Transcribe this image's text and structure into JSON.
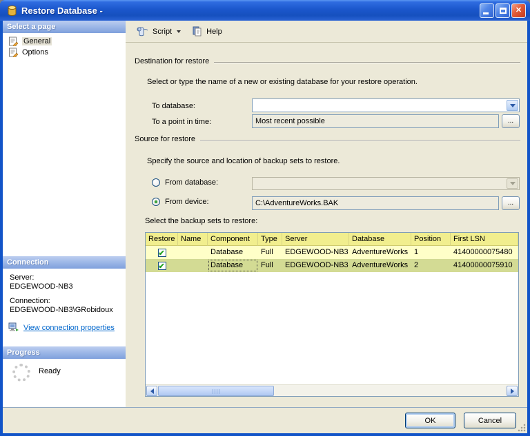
{
  "window": {
    "title": "Restore Database -"
  },
  "sidebar": {
    "select_page": {
      "header": "Select a page",
      "items": [
        {
          "label": "General"
        },
        {
          "label": "Options"
        }
      ]
    },
    "connection": {
      "header": "Connection",
      "server_label": "Server:",
      "server_value": "EDGEWOOD-NB3",
      "connection_label": "Connection:",
      "connection_value": "EDGEWOOD-NB3\\GRobidoux",
      "link_label": "View connection properties"
    },
    "progress": {
      "header": "Progress",
      "status": "Ready"
    }
  },
  "toolbar": {
    "script": "Script",
    "help": "Help"
  },
  "main": {
    "destination": {
      "group": "Destination for restore",
      "description": "Select or type the name of a new or existing database for your restore operation.",
      "to_database_label": "To database:",
      "to_database_value": "",
      "to_point_label": "To a point in time:",
      "to_point_value": "Most recent possible",
      "browse": "..."
    },
    "source": {
      "group": "Source for restore",
      "description": "Specify the source and location of backup sets to restore.",
      "from_database_label": "From database:",
      "from_database_value": "",
      "from_device_label": "From device:",
      "from_device_value": "C:\\AdventureWorks.BAK",
      "browse": "...",
      "backup_sets_label": "Select the backup sets to restore:"
    }
  },
  "table": {
    "columns": [
      "Restore",
      "Name",
      "Component",
      "Type",
      "Server",
      "Database",
      "Position",
      "First LSN"
    ],
    "rows": [
      {
        "restore_checked": true,
        "name": "",
        "component": "Database",
        "type": "Full",
        "server": "EDGEWOOD-NB3",
        "database": "AdventureWorks",
        "position": "1",
        "first_lsn": "41400000075480"
      },
      {
        "restore_checked": true,
        "name": "",
        "component": "Database",
        "type": "Full",
        "server": "EDGEWOOD-NB3",
        "database": "AdventureWorks",
        "position": "2",
        "first_lsn": "41400000075910"
      }
    ]
  },
  "footer": {
    "ok": "OK",
    "cancel": "Cancel"
  },
  "colors": {
    "titlebar_blue": "#1B57CC",
    "section_header_blue": "#9FB9E8",
    "table_header_yellow": "#F1EE8E",
    "table_row_yellow": "#FFFFC8",
    "table_row_olive": "#D3DB94",
    "link_blue": "#0066CC",
    "field_border": "#7F9DB9",
    "content_beige": "#ECE9D8"
  }
}
